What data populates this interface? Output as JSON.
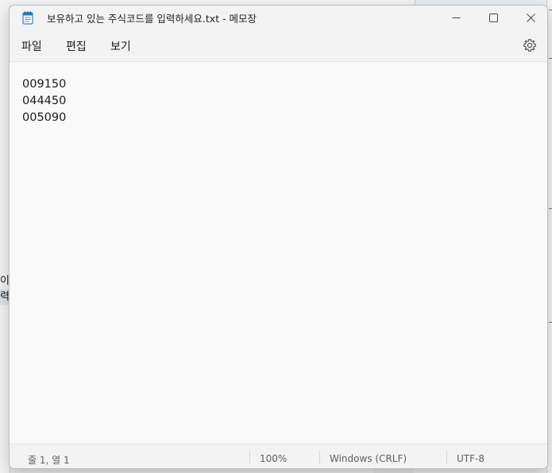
{
  "window": {
    "title": "보유하고 있는 주식코드를 입력하세요.txt - 메모장"
  },
  "menu": {
    "file": "파일",
    "edit": "편집",
    "view": "보기"
  },
  "editor": {
    "lines": [
      "009150",
      "044450",
      "005090"
    ]
  },
  "status": {
    "position": "줄 1, 열 1",
    "zoom": "100%",
    "line_ending": "Windows (CRLF)",
    "encoding": "UTF-8"
  },
  "background": {
    "left_fragment_1": "이",
    "left_fragment_2": "력하"
  },
  "icons": {
    "app": "notepad-icon",
    "minimize": "minimize-icon",
    "maximize": "maximize-icon",
    "close": "close-icon",
    "settings": "gear-icon"
  },
  "colors": {
    "window_bg": "#f9f9f9",
    "chrome_bg": "#f3f3f3",
    "icon_blue": "#1e7fd1"
  }
}
